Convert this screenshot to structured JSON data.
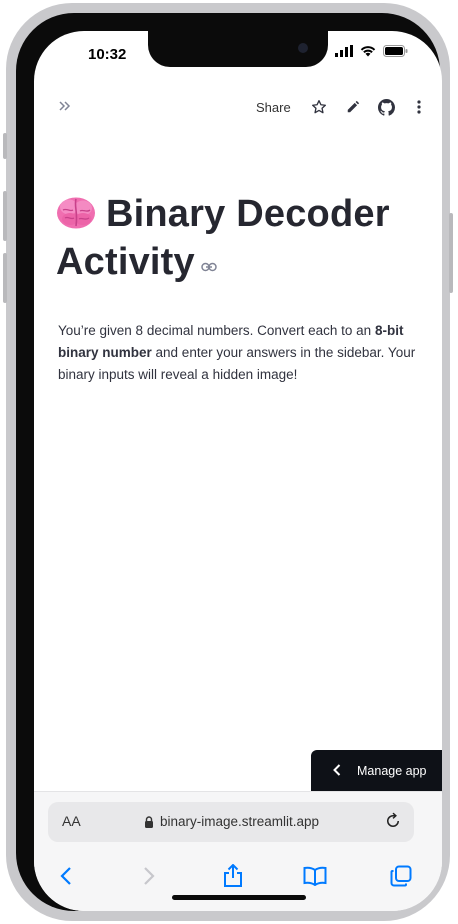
{
  "status": {
    "time": "10:32"
  },
  "toolbar": {
    "share_label": "Share"
  },
  "app": {
    "title_line1": "Binary Decoder",
    "title_line2": "Activity",
    "description_part1": "You’re given 8 decimal numbers. Convert each to an ",
    "description_bold": "8-bit binary number",
    "description_part2": " and enter your answers in the sidebar. Your binary inputs will reveal a hidden image!"
  },
  "manage_app": {
    "label": "Manage app"
  },
  "browser": {
    "aa_label": "AA",
    "url": "binary-image.streamlit.app"
  },
  "colors": {
    "accent": "#007aff",
    "manage_bg": "#0e1117",
    "title": "#262730"
  },
  "icons": [
    "expand-sidebar-icon",
    "star-icon",
    "pencil-icon",
    "github-icon",
    "more-vert-icon",
    "brain-icon",
    "link-icon",
    "lock-icon",
    "reload-icon",
    "back-icon",
    "forward-icon",
    "share-icon",
    "bookmarks-icon",
    "tabs-icon"
  ]
}
